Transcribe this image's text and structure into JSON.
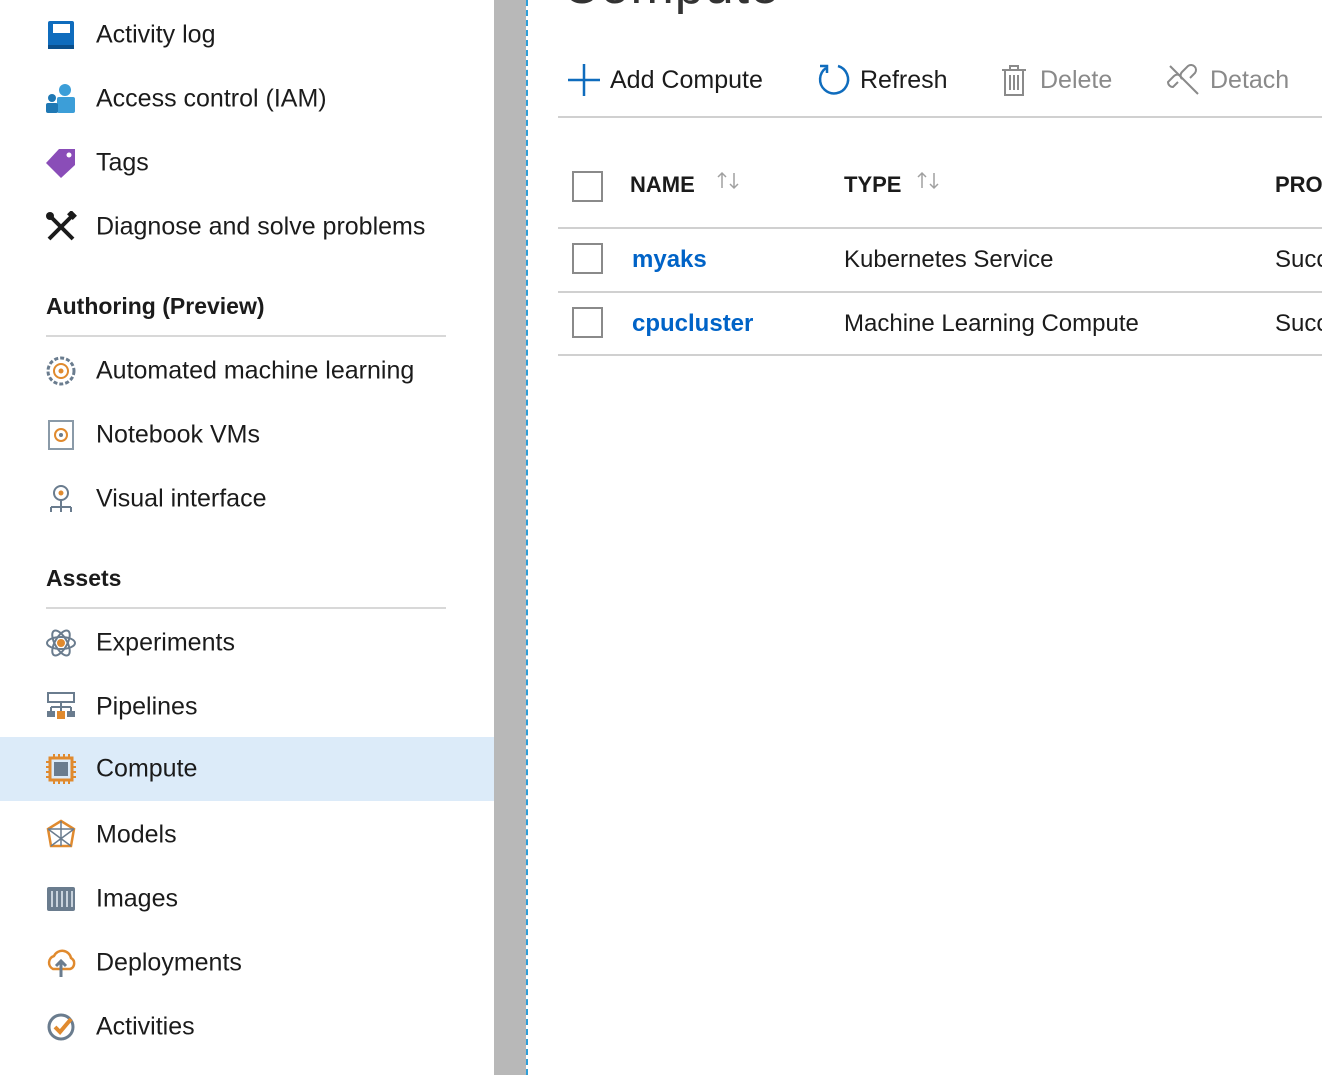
{
  "sidebar": {
    "items_top": [
      {
        "label": "Activity log",
        "icon": "activity-log-icon"
      },
      {
        "label": "Access control (IAM)",
        "icon": "access-control-icon"
      },
      {
        "label": "Tags",
        "icon": "tag-icon"
      },
      {
        "label": "Diagnose and solve problems",
        "icon": "wrench-screwdriver-icon"
      }
    ],
    "sections": [
      {
        "title": "Authoring (Preview)",
        "items": [
          {
            "label": "Automated machine learning",
            "icon": "automl-icon"
          },
          {
            "label": "Notebook VMs",
            "icon": "notebook-icon"
          },
          {
            "label": "Visual interface",
            "icon": "visual-interface-icon"
          }
        ]
      },
      {
        "title": "Assets",
        "items": [
          {
            "label": "Experiments",
            "icon": "experiments-icon"
          },
          {
            "label": "Pipelines",
            "icon": "pipelines-icon"
          },
          {
            "label": "Compute",
            "icon": "compute-icon",
            "selected": true
          },
          {
            "label": "Models",
            "icon": "models-icon"
          },
          {
            "label": "Images",
            "icon": "images-icon"
          },
          {
            "label": "Deployments",
            "icon": "deployments-icon"
          },
          {
            "label": "Activities",
            "icon": "activities-icon"
          }
        ]
      }
    ]
  },
  "main": {
    "title": "Compute",
    "toolbar": {
      "add_label": "Add Compute",
      "refresh_label": "Refresh",
      "delete_label": "Delete",
      "detach_label": "Detach"
    },
    "table": {
      "columns": [
        "NAME",
        "TYPE",
        "PROV"
      ],
      "rows": [
        {
          "name": "myaks",
          "type": "Kubernetes Service",
          "status": "Succ"
        },
        {
          "name": "cpucluster",
          "type": "Machine Learning Compute",
          "status": "Succ"
        }
      ]
    }
  },
  "colors": {
    "accent": "#0063c7",
    "selected_bg": "#dcebf9",
    "splitter": "#b8b8b8",
    "disabled_text": "#8a8a8a"
  }
}
